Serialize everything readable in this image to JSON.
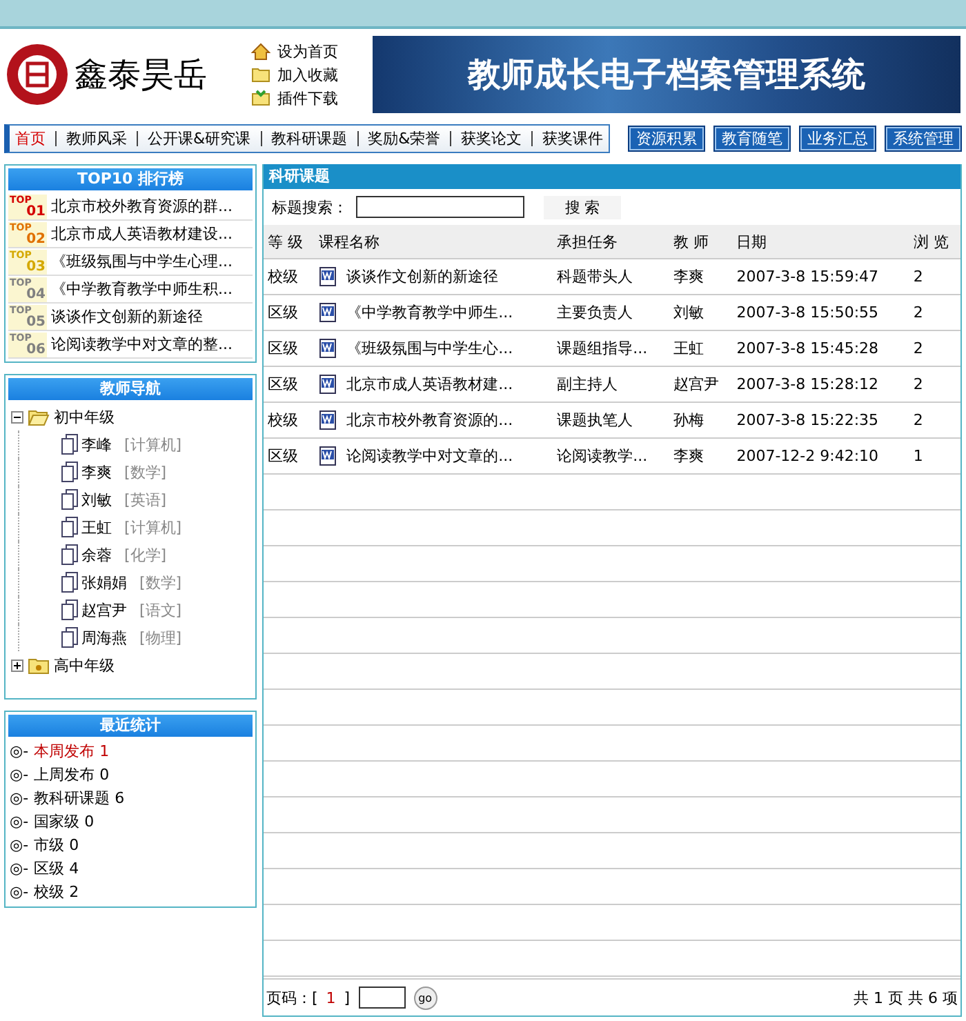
{
  "header": {
    "brand": "鑫泰昊岳",
    "links": [
      {
        "label": "设为首页",
        "kind": "home"
      },
      {
        "label": "加入收藏",
        "kind": "folder"
      },
      {
        "label": "插件下载",
        "kind": "download"
      }
    ],
    "banner_title": "教师成长电子档案管理系统"
  },
  "nav": {
    "tabs": [
      {
        "label": "首页",
        "selected": true
      },
      {
        "label": "教师风采",
        "selected": false
      },
      {
        "label": "公开课&研究课",
        "selected": false
      },
      {
        "label": "教科研课题",
        "selected": false
      },
      {
        "label": "奖励&荣誉",
        "selected": false
      },
      {
        "label": "获奖论文",
        "selected": false
      },
      {
        "label": "获奖课件",
        "selected": false
      }
    ],
    "buttons": [
      "资源积累",
      "教育随笔",
      "业务汇总",
      "系统管理"
    ]
  },
  "top10": {
    "title": "TOP10 排行榜",
    "items": [
      {
        "badge": "TOP",
        "rank": "01",
        "color": "#d40000",
        "title": "北京市校外教育资源的群..."
      },
      {
        "badge": "TOP",
        "rank": "02",
        "color": "#e07000",
        "title": "北京市成人英语教材建设..."
      },
      {
        "badge": "TOP",
        "rank": "03",
        "color": "#d4a800",
        "title": "《班级氛围与中学生心理..."
      },
      {
        "badge": "TOP",
        "rank": "04",
        "color": "#808080",
        "title": "《中学教育教学中师生积..."
      },
      {
        "badge": "TOP",
        "rank": "05",
        "color": "#808080",
        "title": "谈谈作文创新的新途径"
      },
      {
        "badge": "TOP",
        "rank": "06",
        "color": "#808080",
        "title": "论阅读教学中对文章的整..."
      }
    ]
  },
  "teacher_nav": {
    "title": "教师导航",
    "tree": [
      {
        "label": "初中年级",
        "expanded": true,
        "children": [
          {
            "name": "李峰",
            "subject": "[计算机]"
          },
          {
            "name": "李爽",
            "subject": "[数学]"
          },
          {
            "name": "刘敏",
            "subject": "[英语]"
          },
          {
            "name": "王虹",
            "subject": "[计算机]"
          },
          {
            "name": "余蓉",
            "subject": "[化学]"
          },
          {
            "name": "张娟娟",
            "subject": "[数学]"
          },
          {
            "name": "赵宫尹",
            "subject": "[语文]"
          },
          {
            "name": "周海燕",
            "subject": "[物理]"
          }
        ]
      },
      {
        "label": "高中年级",
        "expanded": false
      }
    ]
  },
  "stats": {
    "title": "最近统计",
    "items": [
      {
        "bullet": "◎-",
        "label": "本周发布",
        "count": "1",
        "highlighted": true
      },
      {
        "bullet": "◎-",
        "label": "上周发布",
        "count": "0",
        "highlighted": false
      },
      {
        "bullet": "◎-",
        "label": "教科研课题",
        "count": "6",
        "highlighted": false
      },
      {
        "bullet": "◎-",
        "label": "国家级",
        "count": "0",
        "highlighted": false
      },
      {
        "bullet": "◎-",
        "label": "市级",
        "count": "0",
        "highlighted": false
      },
      {
        "bullet": "◎-",
        "label": "区级",
        "count": "4",
        "highlighted": false
      },
      {
        "bullet": "◎-",
        "label": "校级",
        "count": "2",
        "highlighted": false
      }
    ]
  },
  "main": {
    "title": "科研课题",
    "search": {
      "label": "标题搜索：",
      "button": "搜 索"
    },
    "table": {
      "columns": [
        "等 级",
        "课程名称",
        "承担任务",
        "教 师",
        "日期",
        "浏 览"
      ],
      "rows": [
        [
          "校级",
          "谈谈作文创新的新途径",
          "科题带头人",
          "李爽",
          "2007-3-8 15:59:47",
          "2"
        ],
        [
          "区级",
          "《中学教育教学中师生...",
          "主要负责人",
          "刘敏",
          "2007-3-8 15:50:55",
          "2"
        ],
        [
          "区级",
          "《班级氛围与中学生心...",
          "课题组指导...",
          "王虹",
          "2007-3-8 15:45:28",
          "2"
        ],
        [
          "区级",
          "北京市成人英语教材建...",
          "副主持人",
          "赵宫尹",
          "2007-3-8 15:28:12",
          "2"
        ],
        [
          "校级",
          "北京市校外教育资源的...",
          "课题执笔人",
          "孙梅",
          "2007-3-8 15:22:35",
          "2"
        ],
        [
          "区级",
          "论阅读教学中对文章的...",
          "论阅读教学...",
          "李爽",
          "2007-12-2 9:42:10",
          "1"
        ]
      ]
    },
    "pager": {
      "label": "页码：[",
      "current": "1",
      "close": "]",
      "go": "go",
      "summary": "共 1 页 共 6 项"
    }
  }
}
